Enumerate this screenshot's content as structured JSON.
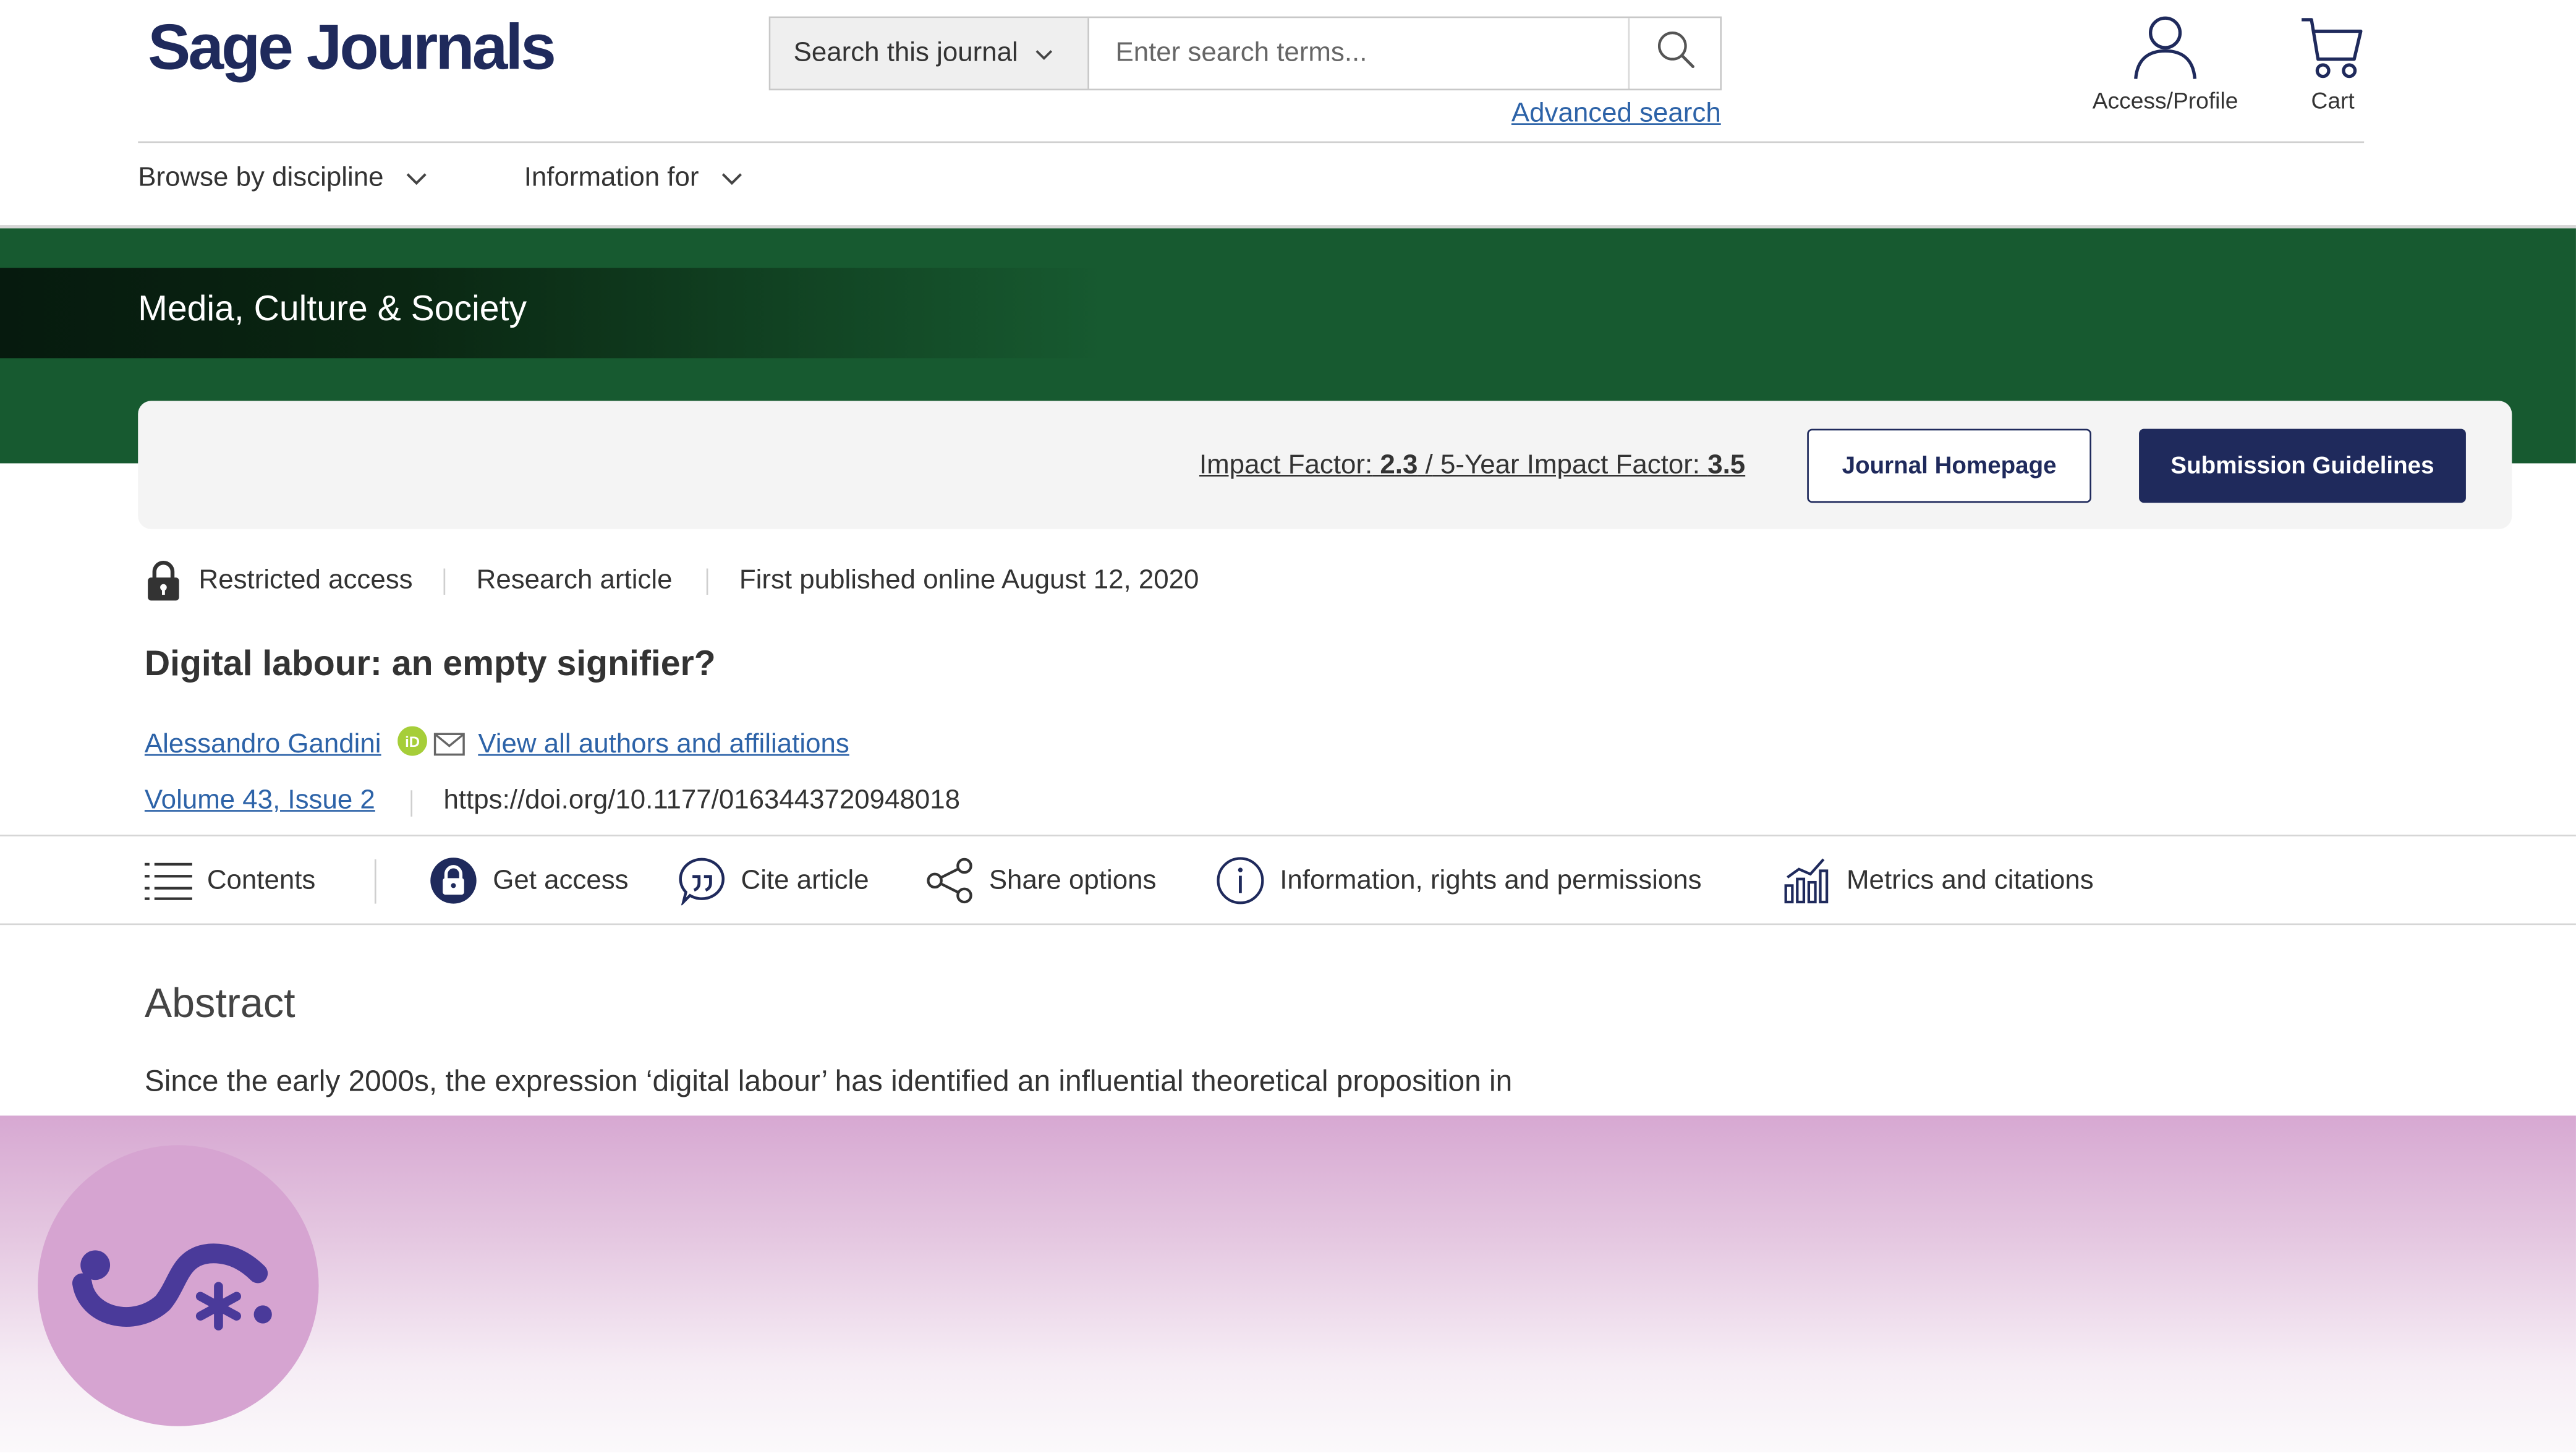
{
  "header": {
    "logo": "Sage Journals",
    "search_scope": "Search this journal",
    "search_placeholder": "Enter search terms...",
    "advanced_search": "Advanced search",
    "access_profile": "Access/Profile",
    "cart": "Cart"
  },
  "nav": {
    "browse": "Browse by discipline",
    "info": "Information for"
  },
  "journal": {
    "name": "Media, Culture & Society",
    "impact_label": "Impact Factor:",
    "impact_value": "2.3",
    "slash": "/",
    "five_year_label": "5-Year Impact Factor:",
    "five_year_value": "3.5",
    "homepage_button": "Journal Homepage",
    "submission_button": "Submission Guidelines"
  },
  "article": {
    "access": "Restricted access",
    "type": "Research article",
    "published": "First published online August 12, 2020",
    "title": "Digital labour: an empty signifier?",
    "author": "Alessandro Gandini",
    "view_all": "View all authors and affiliations",
    "volume": "Volume 43, Issue 2",
    "doi": "https://doi.org/10.1177/0163443720948018"
  },
  "toolbar": {
    "contents": "Contents",
    "get_access": "Get access",
    "cite": "Cite article",
    "share": "Share options",
    "info": "Information, rights and permissions",
    "metrics": "Metrics and citations"
  },
  "abstract": {
    "heading": "Abstract",
    "text": "Since the early 2000s, the expression ‘digital labour’ has identified an influential theoretical proposition in"
  },
  "colors": {
    "brand_navy": "#1f2a5c",
    "banner_green": "#175a30",
    "link_blue": "#2d63a8",
    "orcid_green": "#a6ce39",
    "overlay_purple": "#d6a4d1",
    "badge_logo": "#4a3a9a"
  }
}
